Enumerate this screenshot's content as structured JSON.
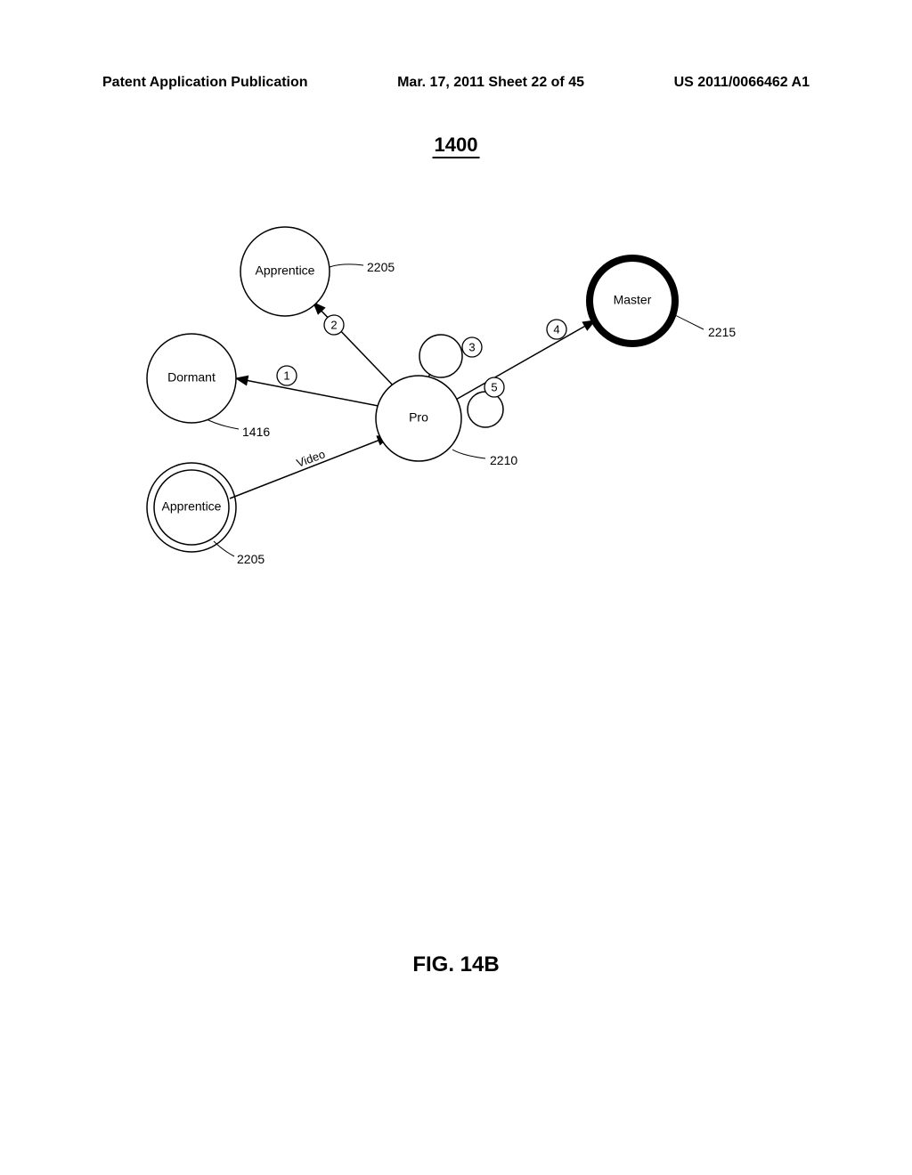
{
  "header": {
    "left": "Patent Application Publication",
    "center": "Mar. 17, 2011  Sheet 22 of 45",
    "right": "US 2011/0066462 A1"
  },
  "figure": {
    "number": "1400",
    "caption": "FIG. 14B"
  },
  "nodes": {
    "apprentice_top": {
      "label": "Apprentice",
      "ref": "2205"
    },
    "dormant": {
      "label": "Dormant",
      "ref": "1416"
    },
    "pro": {
      "label": "Pro",
      "ref": "2210"
    },
    "master": {
      "label": "Master",
      "ref": "2215"
    },
    "apprentice_bottom": {
      "label": "Apprentice",
      "ref": "2205"
    }
  },
  "edges": {
    "step1": "1",
    "step2": "2",
    "step3": "3",
    "step4": "4",
    "step5": "5",
    "video": "Video"
  }
}
